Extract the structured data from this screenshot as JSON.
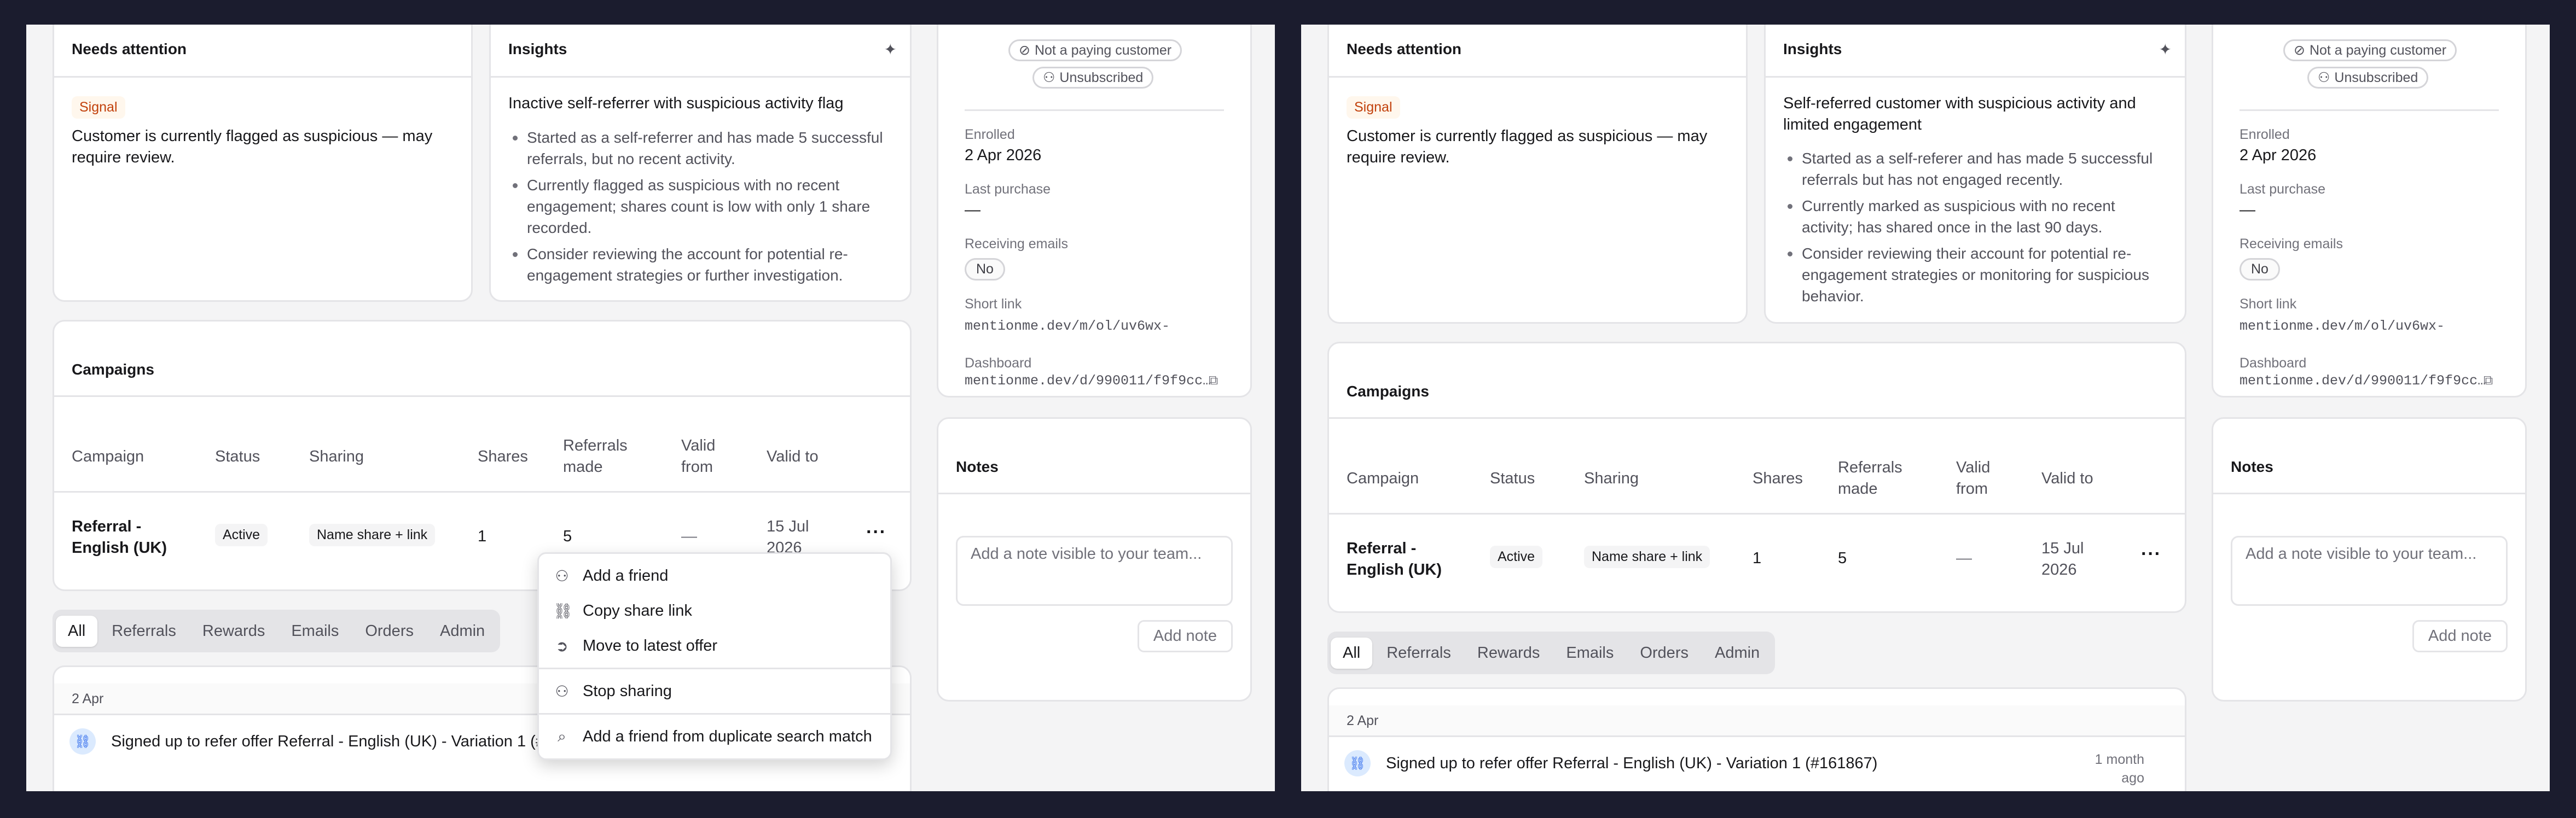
{
  "needs_attention": {
    "title": "Needs attention",
    "badge": "Signal",
    "text": "Customer is currently flagged as suspicious — may require review."
  },
  "insights_left": {
    "title": "Insights",
    "headline": "Inactive self-referrer with suspicious activity flag",
    "bullets": [
      "Started as a self-referrer and has made 5 successful referrals, but no recent activity.",
      "Currently flagged as suspicious with no recent engagement; shares count is low with only 1 share recorded.",
      "Consider reviewing the account for potential re-engagement strategies or further investigation."
    ]
  },
  "insights_right": {
    "title": "Insights",
    "headline": "Self-referred customer with suspicious activity and limited engagement",
    "bullets": [
      "Started as a self-referer and has made 5 successful referrals but has not engaged recently.",
      "Currently marked as suspicious with no recent activity; has shared once in the last 90 days.",
      "Consider reviewing their account for potential re-engagement strategies or monitoring for suspicious behavior."
    ]
  },
  "profile": {
    "not_paying": "Not a paying customer",
    "unsubscribed": "Unsubscribed",
    "enrolled_label": "Enrolled",
    "enrolled_value": "2 Apr 2026",
    "last_purchase_label": "Last purchase",
    "last_purchase_value": "—",
    "receiving_emails_label": "Receiving emails",
    "receiving_emails_value": "No",
    "short_link_label": "Short link",
    "short_link_value": "mentionme.dev/m/ol/uv6wx-",
    "dashboard_label": "Dashboard",
    "dashboard_value": "mentionme.dev/d/990011/f9f9cc…"
  },
  "campaigns": {
    "title": "Campaigns",
    "headers": [
      "Campaign",
      "Status",
      "Sharing",
      "Shares",
      "Referrals made",
      "Valid from",
      "Valid to"
    ],
    "row": {
      "campaign": "Referral - English (UK)",
      "status": "Active",
      "sharing": "Name share + link",
      "shares": "1",
      "referrals": "5",
      "valid_from": "—",
      "valid_to": "15 Jul 2026"
    },
    "more": "···"
  },
  "tabs": [
    "All",
    "Referrals",
    "Rewards",
    "Emails",
    "Orders",
    "Admin"
  ],
  "activity": {
    "date": "2 Apr",
    "text": "Signed up to refer offer Referral - English (UK) - Variation 1 (#161867)",
    "time": "1 month ago",
    "time_short": "ago"
  },
  "notes": {
    "title": "Notes",
    "placeholder": "Add a note visible to your team...",
    "button": "Add note"
  },
  "menu": {
    "items": [
      "Add a friend",
      "Copy share link",
      "Move to latest offer",
      "Stop sharing",
      "Add a friend from duplicate search match"
    ]
  },
  "colors": {
    "frame_bg": "#1b1c2e",
    "panel_bg": "#f4f4f5",
    "signal": "#c2410c",
    "link_icon": "#2563eb"
  },
  "icons": {
    "sparkle": "sparkle-icon",
    "check_circle": "check-circle-icon",
    "user": "user-icon",
    "external": "external-link-icon",
    "link": "link-icon",
    "user_plus": "user-plus-icon",
    "arrow_circle": "arrow-right-circle-icon",
    "user_minus": "user-minus-icon",
    "search": "search-icon"
  }
}
